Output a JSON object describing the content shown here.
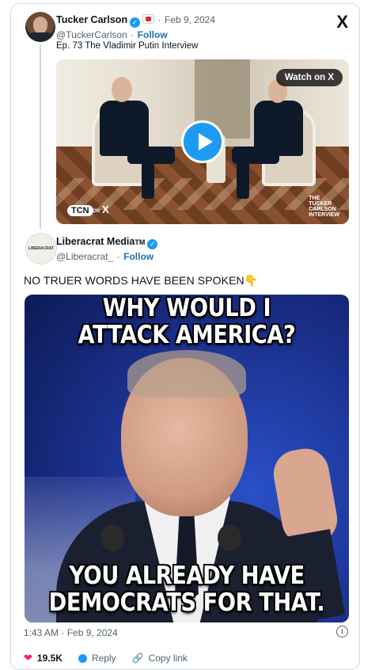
{
  "quoted_tweet": {
    "author_name": "Tucker Carlson",
    "handle": "@TuckerCarlson",
    "date": "Feb 9, 2024",
    "separator": "·",
    "follow_label": "Follow",
    "text": "Ep. 73  The Vladimir Putin Interview",
    "video": {
      "watch_label": "Watch on X",
      "tcn_label": "TCN",
      "on_label": "ON",
      "x_label": "X",
      "tci_lines": [
        "THE",
        "TUCKER",
        "CARLSON",
        "INTERVIEW"
      ]
    },
    "verified_icon": "verified-check-icon",
    "brand_badge_icon": "youtube-badge-icon"
  },
  "x_logo": "X",
  "main_tweet": {
    "author_name": "Liberacrat Media",
    "tm": "TM",
    "handle": "@Liberacrat_",
    "separator": "·",
    "follow_label": "Follow",
    "avatar_text": "LIBERACRAT",
    "text": "NO TRUER WORDS HAVE BEEN SPOKEN",
    "emoji": "👇",
    "meme_top": [
      "WHY WOULD I",
      "ATTACK AMERICA?"
    ],
    "meme_bottom": [
      "YOU ALREADY HAVE",
      "DEMOCRATS FOR THAT."
    ],
    "timestamp": "1:43 AM · Feb 9, 2024",
    "info_icon": "i"
  },
  "actions": {
    "likes": "19.5K",
    "reply_label": "Reply",
    "copy_label": "Copy link"
  },
  "colors": {
    "accent": "#1d9bf0",
    "follow": "#1d70b8",
    "border": "#cfd9de",
    "muted": "#536471",
    "heart": "#f91880"
  }
}
